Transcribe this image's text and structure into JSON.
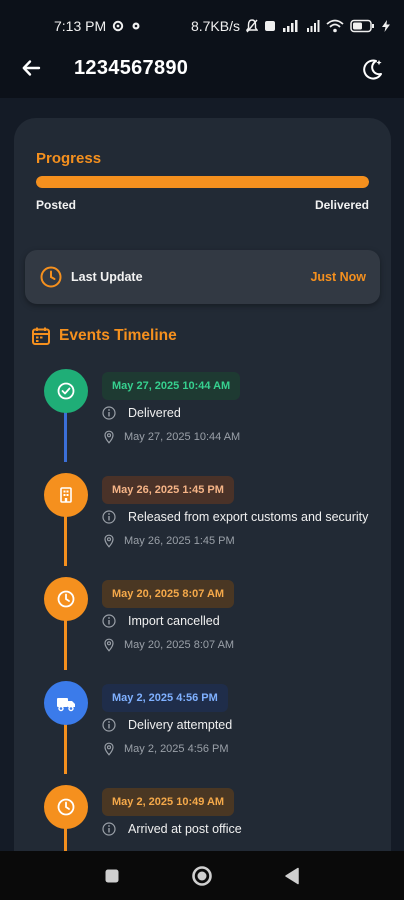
{
  "status_bar": {
    "time": "7:13 PM",
    "net_speed": "8.7KB/s",
    "battery": "49"
  },
  "header": {
    "title": "1234567890",
    "back_icon": "arrow-left-icon",
    "theme_icon": "moon-icon"
  },
  "progress": {
    "title": "Progress",
    "fraction": 1.0,
    "start_label": "Posted",
    "end_label": "Delivered"
  },
  "last_update": {
    "label": "Last Update",
    "value": "Just Now"
  },
  "timeline": {
    "title": "Events Timeline",
    "events": [
      {
        "date": "May 27, 2025 10:44 AM",
        "description": "Delivered",
        "location": "May 27, 2025 10:44 AM",
        "icon": "check-circle-icon",
        "color": "#1fae77",
        "badge_bg": "#1e3a32",
        "badge_text": "#36d08f"
      },
      {
        "date": "May 26, 2025 1:45 PM",
        "description": "Released from export customs and security",
        "location": "May 26, 2025 1:45 PM",
        "icon": "building-icon",
        "color": "#f5901e",
        "badge_bg": "#4a3228",
        "badge_text": "#f5b487"
      },
      {
        "date": "May 20, 2025 8:07 AM",
        "description": "Import cancelled",
        "location": "May 20, 2025 8:07 AM",
        "icon": "clock-icon",
        "color": "#f5901e",
        "badge_bg": "#4a3723",
        "badge_text": "#f5a94a"
      },
      {
        "date": "May 2, 2025 4:56 PM",
        "description": "Delivery attempted",
        "location": "May 2, 2025 4:56 PM",
        "icon": "truck-icon",
        "color": "#3b7bea",
        "badge_bg": "#1f2d4a",
        "badge_text": "#7fb0ff"
      },
      {
        "date": "May 2, 2025 10:49 AM",
        "description": "Arrived at post office",
        "location": "",
        "icon": "clock-icon",
        "color": "#f5901e",
        "badge_bg": "#4a3723",
        "badge_text": "#f5a94a"
      }
    ]
  },
  "colors": {
    "accent": "#f5901e",
    "card_bg": "#222a35",
    "page_bg": "#141b26"
  }
}
